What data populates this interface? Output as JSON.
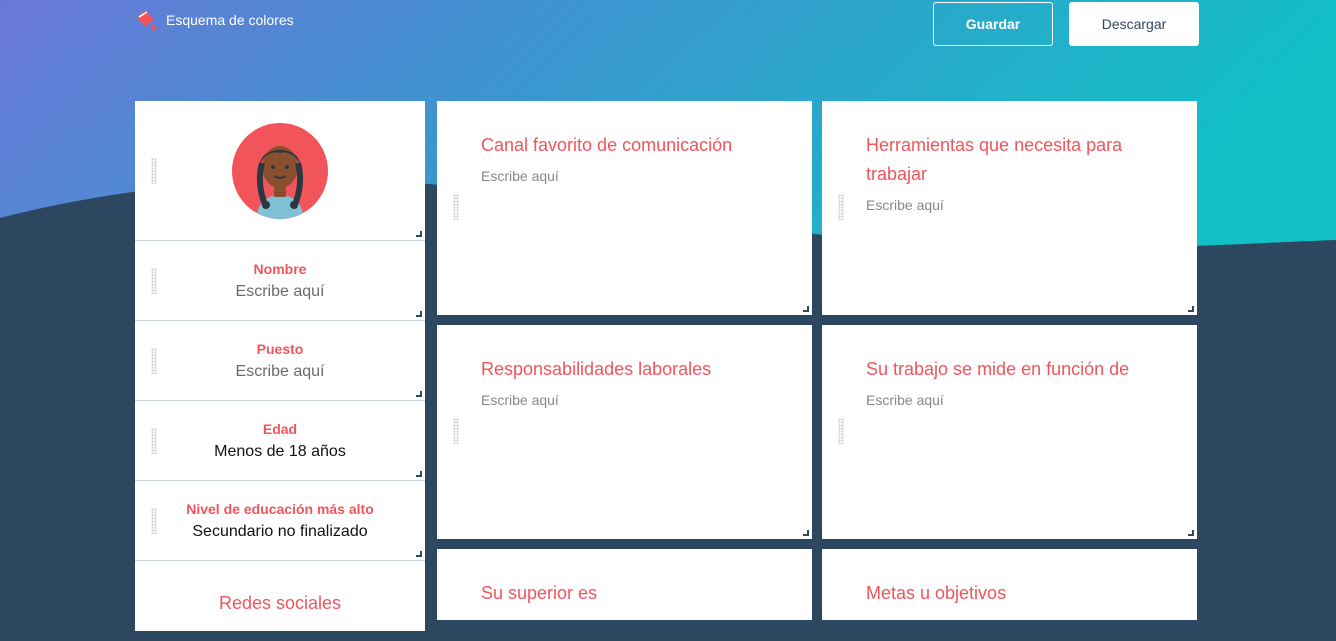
{
  "toolbar": {
    "color_scheme_label": "Esquema de colores",
    "save_label": "Guardar",
    "download_label": "Descargar"
  },
  "colors": {
    "accent": "#f2545b",
    "dark_bg": "#2e4760",
    "gradient_start": "#6a78d8",
    "gradient_end": "#12c0c6"
  },
  "profile": {
    "avatar_icon": "girl-avatar-icon",
    "fields": [
      {
        "label": "Nombre",
        "value": "Escribe aquí"
      },
      {
        "label": "Puesto",
        "value": "Escribe aquí"
      },
      {
        "label": "Edad",
        "value": "Menos de 18 años"
      },
      {
        "label": "Nivel de educación más alto",
        "value": "Secundario no finalizado"
      }
    ],
    "social_title": "Redes sociales"
  },
  "cards": [
    {
      "title": "Canal favorito de comunicación",
      "placeholder": "Escribe aquí"
    },
    {
      "title": "Herramientas que necesita para trabajar",
      "placeholder": "Escribe aquí"
    },
    {
      "title": "Responsabilidades laborales",
      "placeholder": "Escribe aquí"
    },
    {
      "title": "Su trabajo se mide en función de",
      "placeholder": "Escribe aquí"
    },
    {
      "title": "Su superior es",
      "placeholder": ""
    },
    {
      "title": "Metas u objetivos",
      "placeholder": ""
    }
  ]
}
